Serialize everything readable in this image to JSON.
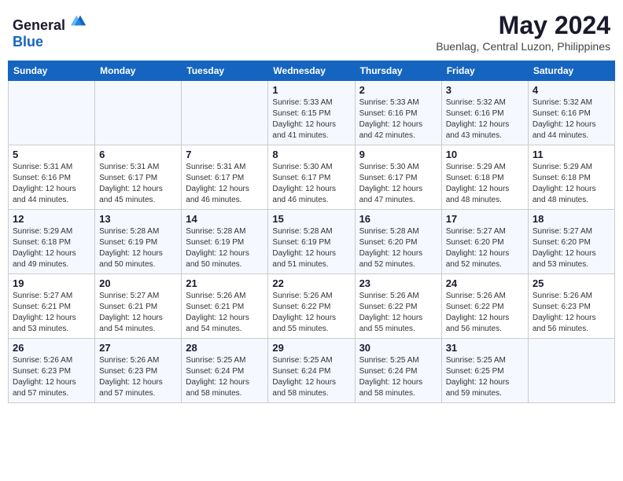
{
  "header": {
    "logo_general": "General",
    "logo_blue": "Blue",
    "month_year": "May 2024",
    "location": "Buenlag, Central Luzon, Philippines"
  },
  "days_of_week": [
    "Sunday",
    "Monday",
    "Tuesday",
    "Wednesday",
    "Thursday",
    "Friday",
    "Saturday"
  ],
  "weeks": [
    [
      {
        "day": "",
        "sunrise": "",
        "sunset": "",
        "daylight": ""
      },
      {
        "day": "",
        "sunrise": "",
        "sunset": "",
        "daylight": ""
      },
      {
        "day": "",
        "sunrise": "",
        "sunset": "",
        "daylight": ""
      },
      {
        "day": "1",
        "sunrise": "Sunrise: 5:33 AM",
        "sunset": "Sunset: 6:15 PM",
        "daylight": "Daylight: 12 hours and 41 minutes."
      },
      {
        "day": "2",
        "sunrise": "Sunrise: 5:33 AM",
        "sunset": "Sunset: 6:16 PM",
        "daylight": "Daylight: 12 hours and 42 minutes."
      },
      {
        "day": "3",
        "sunrise": "Sunrise: 5:32 AM",
        "sunset": "Sunset: 6:16 PM",
        "daylight": "Daylight: 12 hours and 43 minutes."
      },
      {
        "day": "4",
        "sunrise": "Sunrise: 5:32 AM",
        "sunset": "Sunset: 6:16 PM",
        "daylight": "Daylight: 12 hours and 44 minutes."
      }
    ],
    [
      {
        "day": "5",
        "sunrise": "Sunrise: 5:31 AM",
        "sunset": "Sunset: 6:16 PM",
        "daylight": "Daylight: 12 hours and 44 minutes."
      },
      {
        "day": "6",
        "sunrise": "Sunrise: 5:31 AM",
        "sunset": "Sunset: 6:17 PM",
        "daylight": "Daylight: 12 hours and 45 minutes."
      },
      {
        "day": "7",
        "sunrise": "Sunrise: 5:31 AM",
        "sunset": "Sunset: 6:17 PM",
        "daylight": "Daylight: 12 hours and 46 minutes."
      },
      {
        "day": "8",
        "sunrise": "Sunrise: 5:30 AM",
        "sunset": "Sunset: 6:17 PM",
        "daylight": "Daylight: 12 hours and 46 minutes."
      },
      {
        "day": "9",
        "sunrise": "Sunrise: 5:30 AM",
        "sunset": "Sunset: 6:17 PM",
        "daylight": "Daylight: 12 hours and 47 minutes."
      },
      {
        "day": "10",
        "sunrise": "Sunrise: 5:29 AM",
        "sunset": "Sunset: 6:18 PM",
        "daylight": "Daylight: 12 hours and 48 minutes."
      },
      {
        "day": "11",
        "sunrise": "Sunrise: 5:29 AM",
        "sunset": "Sunset: 6:18 PM",
        "daylight": "Daylight: 12 hours and 48 minutes."
      }
    ],
    [
      {
        "day": "12",
        "sunrise": "Sunrise: 5:29 AM",
        "sunset": "Sunset: 6:18 PM",
        "daylight": "Daylight: 12 hours and 49 minutes."
      },
      {
        "day": "13",
        "sunrise": "Sunrise: 5:28 AM",
        "sunset": "Sunset: 6:19 PM",
        "daylight": "Daylight: 12 hours and 50 minutes."
      },
      {
        "day": "14",
        "sunrise": "Sunrise: 5:28 AM",
        "sunset": "Sunset: 6:19 PM",
        "daylight": "Daylight: 12 hours and 50 minutes."
      },
      {
        "day": "15",
        "sunrise": "Sunrise: 5:28 AM",
        "sunset": "Sunset: 6:19 PM",
        "daylight": "Daylight: 12 hours and 51 minutes."
      },
      {
        "day": "16",
        "sunrise": "Sunrise: 5:28 AM",
        "sunset": "Sunset: 6:20 PM",
        "daylight": "Daylight: 12 hours and 52 minutes."
      },
      {
        "day": "17",
        "sunrise": "Sunrise: 5:27 AM",
        "sunset": "Sunset: 6:20 PM",
        "daylight": "Daylight: 12 hours and 52 minutes."
      },
      {
        "day": "18",
        "sunrise": "Sunrise: 5:27 AM",
        "sunset": "Sunset: 6:20 PM",
        "daylight": "Daylight: 12 hours and 53 minutes."
      }
    ],
    [
      {
        "day": "19",
        "sunrise": "Sunrise: 5:27 AM",
        "sunset": "Sunset: 6:21 PM",
        "daylight": "Daylight: 12 hours and 53 minutes."
      },
      {
        "day": "20",
        "sunrise": "Sunrise: 5:27 AM",
        "sunset": "Sunset: 6:21 PM",
        "daylight": "Daylight: 12 hours and 54 minutes."
      },
      {
        "day": "21",
        "sunrise": "Sunrise: 5:26 AM",
        "sunset": "Sunset: 6:21 PM",
        "daylight": "Daylight: 12 hours and 54 minutes."
      },
      {
        "day": "22",
        "sunrise": "Sunrise: 5:26 AM",
        "sunset": "Sunset: 6:22 PM",
        "daylight": "Daylight: 12 hours and 55 minutes."
      },
      {
        "day": "23",
        "sunrise": "Sunrise: 5:26 AM",
        "sunset": "Sunset: 6:22 PM",
        "daylight": "Daylight: 12 hours and 55 minutes."
      },
      {
        "day": "24",
        "sunrise": "Sunrise: 5:26 AM",
        "sunset": "Sunset: 6:22 PM",
        "daylight": "Daylight: 12 hours and 56 minutes."
      },
      {
        "day": "25",
        "sunrise": "Sunrise: 5:26 AM",
        "sunset": "Sunset: 6:23 PM",
        "daylight": "Daylight: 12 hours and 56 minutes."
      }
    ],
    [
      {
        "day": "26",
        "sunrise": "Sunrise: 5:26 AM",
        "sunset": "Sunset: 6:23 PM",
        "daylight": "Daylight: 12 hours and 57 minutes."
      },
      {
        "day": "27",
        "sunrise": "Sunrise: 5:26 AM",
        "sunset": "Sunset: 6:23 PM",
        "daylight": "Daylight: 12 hours and 57 minutes."
      },
      {
        "day": "28",
        "sunrise": "Sunrise: 5:25 AM",
        "sunset": "Sunset: 6:24 PM",
        "daylight": "Daylight: 12 hours and 58 minutes."
      },
      {
        "day": "29",
        "sunrise": "Sunrise: 5:25 AM",
        "sunset": "Sunset: 6:24 PM",
        "daylight": "Daylight: 12 hours and 58 minutes."
      },
      {
        "day": "30",
        "sunrise": "Sunrise: 5:25 AM",
        "sunset": "Sunset: 6:24 PM",
        "daylight": "Daylight: 12 hours and 58 minutes."
      },
      {
        "day": "31",
        "sunrise": "Sunrise: 5:25 AM",
        "sunset": "Sunset: 6:25 PM",
        "daylight": "Daylight: 12 hours and 59 minutes."
      },
      {
        "day": "",
        "sunrise": "",
        "sunset": "",
        "daylight": ""
      }
    ]
  ]
}
